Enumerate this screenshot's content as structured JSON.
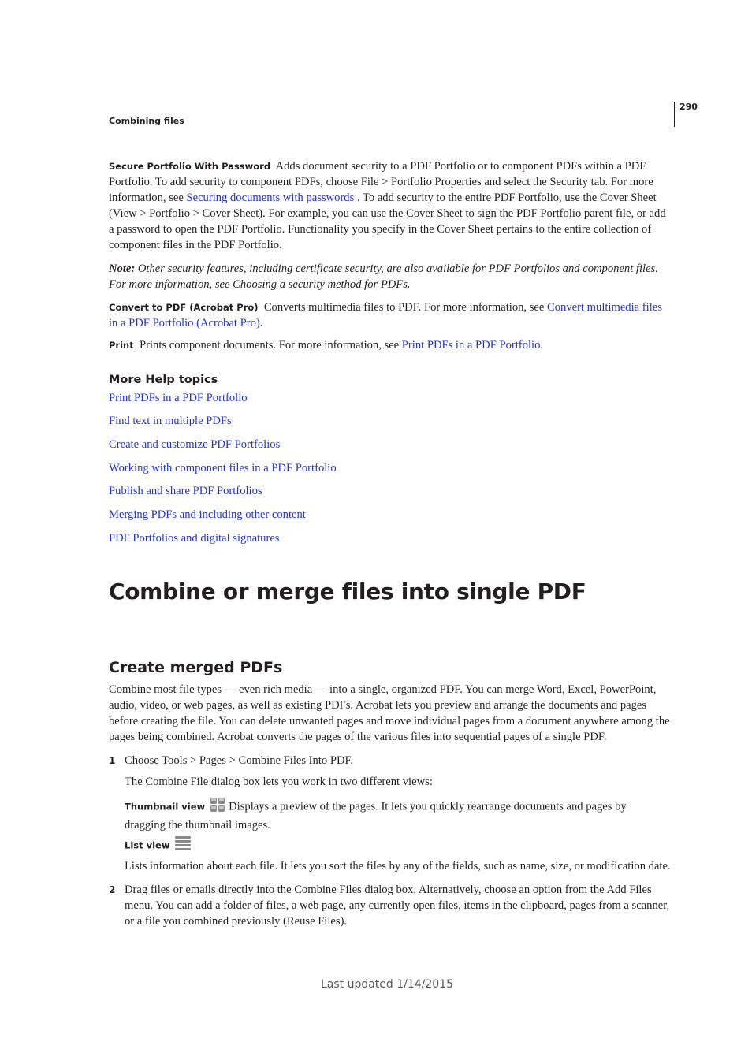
{
  "header": {
    "running_head": "Combining files",
    "page_number": "290"
  },
  "sections": {
    "secure": {
      "term": "Secure Portfolio With Password",
      "text1": "Adds document security to a PDF Portfolio or to component PDFs within a PDF Portfolio. To add security to component PDFs, choose File > Portfolio Properties and select the Security tab. For more information, see ",
      "link": "Securing documents with passwords",
      "text2": " . To add security to the entire PDF Portfolio, use the Cover Sheet (View > Portfolio > Cover Sheet). For example, you can use the Cover Sheet to sign the PDF Portfolio parent file, or add a password to open the PDF Portfolio. Functionality you specify in the Cover Sheet pertains to the entire collection of component files in the PDF Portfolio."
    },
    "note": {
      "label": "Note:",
      "text": " Other security features, including certificate security, are also available for PDF Portfolios and component files. For more information, see Choosing a security method for PDFs."
    },
    "convert": {
      "term": "Convert to PDF (Acrobat Pro)",
      "text1": "Converts multimedia files to PDF. For more information, see ",
      "link": "Convert multimedia files in a PDF Portfolio (Acrobat Pro)",
      "text2": "."
    },
    "print": {
      "term": "Print",
      "text1": "Prints component documents. For more information, see ",
      "link": "Print PDFs in a PDF Portfolio",
      "text2": "."
    }
  },
  "more_help": {
    "heading": "More Help topics",
    "links": [
      "Print PDFs in a PDF Portfolio",
      "Find text in multiple PDFs",
      "Create and customize PDF Portfolios",
      "Working with component files in a PDF Portfolio",
      "Publish and share PDF Portfolios",
      "Merging PDFs and including other content",
      "PDF Portfolios and digital signatures"
    ]
  },
  "main_heading": "Combine or merge files into single PDF",
  "sub_heading": "Create merged PDFs",
  "intro": "Combine most file types — even rich media — into a single, organized PDF. You can merge Word, Excel, PowerPoint, audio, video, or web pages, as well as existing PDFs. Acrobat lets you preview and arrange the documents and pages before creating the file. You can delete unwanted pages and move individual pages from a document anywhere among the pages being combined. Acrobat converts the pages of the various files into sequential pages of a single PDF.",
  "steps": [
    {
      "num": "1",
      "text": "Choose Tools > Pages > Combine Files Into PDF.",
      "sub": "The Combine File dialog box lets you work in two different views:",
      "views": [
        {
          "term": "Thumbnail view",
          "icon": "thumbnail-grid-icon",
          "text": "Displays a preview of the pages. It lets you quickly rearrange documents and pages by dragging the thumbnail images."
        },
        {
          "term": "List view",
          "icon": "list-view-icon",
          "text": "Lists information about each file. It lets you sort the files by any of the fields, such as name, size, or modification date."
        }
      ]
    },
    {
      "num": "2",
      "text": "Drag files or emails directly into the Combine Files dialog box. Alternatively, choose an option from the Add Files menu. You can add a folder of files, a web page, any currently open files, items in the clipboard, pages from a scanner, or a file you combined previously (Reuse Files)."
    }
  ],
  "footer": "Last updated 1/14/2015"
}
